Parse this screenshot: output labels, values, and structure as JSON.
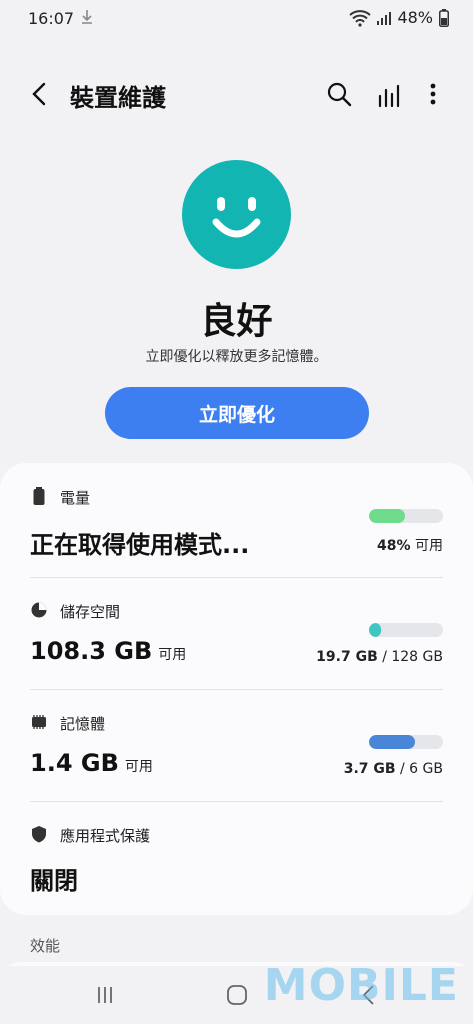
{
  "status_bar": {
    "time": "16:07",
    "battery_pct": "48%"
  },
  "header": {
    "title": "裝置維護"
  },
  "hero": {
    "status_word": "良好",
    "subtitle": "立即優化以釋放更多記憶體。",
    "optimize_label": "立即優化"
  },
  "battery": {
    "label": "電量",
    "value": "正在取得使用模式...",
    "pct": "48%",
    "pct_suffix": " 可用",
    "level": 0.48,
    "color": "#6fdc8c"
  },
  "storage": {
    "label": "儲存空間",
    "value": "108.3 GB",
    "value_suffix": "可用",
    "used": "19.7 GB",
    "total": " / 128 GB",
    "level": 0.154,
    "color": "#3fc6c0"
  },
  "memory": {
    "label": "記憶體",
    "value": "1.4 GB",
    "value_suffix": "可用",
    "used": "3.7 GB",
    "total": " / 6 GB",
    "level": 0.617,
    "color": "#4a86d8"
  },
  "app_protection": {
    "label": "應用程式保護",
    "value": "關閉"
  },
  "section_performance": "效能",
  "watermark": "MOBILE"
}
